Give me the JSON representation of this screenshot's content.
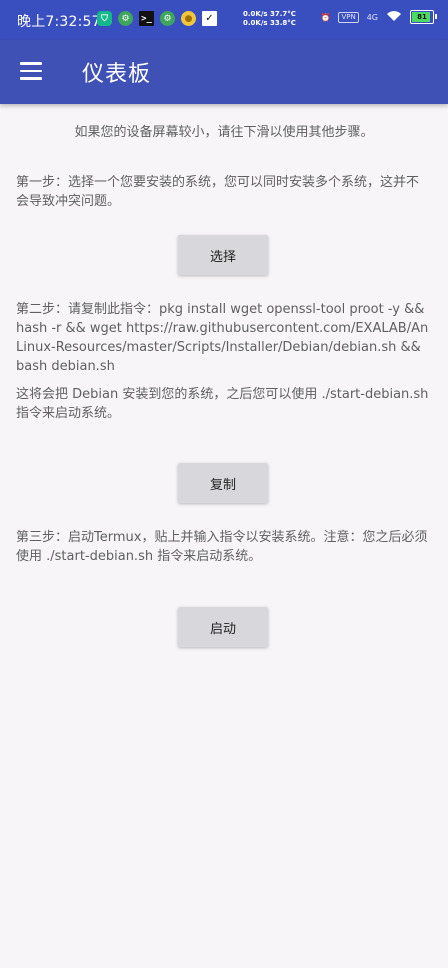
{
  "status_bar": {
    "time": "晚上7:32:57",
    "icons": [
      "shield-app-icon",
      "settings-gear-icon",
      "terminal-icon",
      "settings-gear-icon",
      "yellow-app-icon",
      "check-app-icon"
    ],
    "speed_up": "0.0K/s 37.7°C",
    "speed_down": "0.0K/s 33.8°C",
    "vpn": "VPN",
    "signal": "4G",
    "battery": "81"
  },
  "app_bar": {
    "title": "仪表板"
  },
  "content": {
    "hint": "如果您的设备屏幕较小，请往下滑以使用其他步骤。",
    "step1": "第一步：选择一个您要安装的系统，您可以同时安装多个系统，这并不会导致冲突问题。",
    "select_button": "选择",
    "step2": "第二步：请复制此指令：pkg install wget openssl-tool proot -y && hash -r && wget https://raw.githubusercontent.com/EXALAB/AnLinux-Resources/master/Scripts/Installer/Debian/debian.sh && bash debian.sh",
    "note": "这将会把 Debian 安装到您的系统，之后您可以使用 ./start-debian.sh 指令来启动系统。",
    "copy_button": "复制",
    "step3": "第三步：启动Termux，贴上并输入指令以安装系统。注意：您之后必须使用 ./start-debian.sh 指令来启动系统。",
    "launch_button": "启动"
  }
}
